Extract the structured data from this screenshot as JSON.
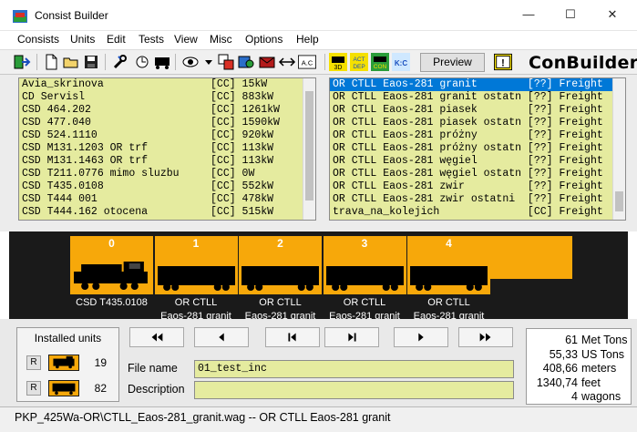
{
  "window": {
    "title": "Consist Builder",
    "minimize_glyph": "—",
    "maximize_glyph": "☐",
    "close_glyph": "✕"
  },
  "menu": [
    "Consists",
    "Units",
    "Edit",
    "Tests",
    "View",
    "Misc",
    "Options",
    "Help"
  ],
  "toolbar": {
    "preview_label": "Preview",
    "brand": "ConBuilder",
    "icons": [
      "exit-icon",
      "new-icon",
      "open-icon",
      "save-icon",
      "tools-icon",
      "search-icon",
      "wagon-icon",
      "view-icon",
      "dropdown-icon",
      "replace-icon",
      "match-icon",
      "mail-icon",
      "swap-icon",
      "ac-icon",
      "3d-icon",
      "act-dep-icon",
      "con-icon",
      "kc-icon",
      "help-icon"
    ],
    "ac_label": "A.C",
    "3d_label": "3D",
    "act_dep_label": "ACT DEP",
    "con_label": "CON",
    "kc_label": "K:C"
  },
  "left_list": [
    {
      "name": "Avia_skrinova",
      "tag": "[CC]",
      "value": "15kW"
    },
    {
      "name": "CD Servisl",
      "tag": "[CC]",
      "value": "883kW"
    },
    {
      "name": "CSD 464.202",
      "tag": "[CC]",
      "value": "1261kW"
    },
    {
      "name": "CSD 477.040",
      "tag": "[CC]",
      "value": "1590kW"
    },
    {
      "name": "CSD 524.1110",
      "tag": "[CC]",
      "value": "920kW"
    },
    {
      "name": "CSD M131.1203 OR trf",
      "tag": "[CC]",
      "value": "113kW"
    },
    {
      "name": "CSD M131.1463 OR trf",
      "tag": "[CC]",
      "value": "113kW"
    },
    {
      "name": "CSD T211.0776 mimo sluzbu",
      "tag": "[CC]",
      "value": "0W"
    },
    {
      "name": "CSD T435.0108",
      "tag": "[CC]",
      "value": "552kW"
    },
    {
      "name": "CSD T444 001",
      "tag": "[CC]",
      "value": "478kW"
    },
    {
      "name": "CSD T444.162 otocena",
      "tag": "[CC]",
      "value": "515kW"
    }
  ],
  "right_list": [
    {
      "name": "OR CTLL Eaos-281 granit",
      "tag": "[??]",
      "value": "Freight",
      "selected": true
    },
    {
      "name": "OR CTLL Eaos-281 granit ostatn",
      "tag": "[??]",
      "value": "Freight"
    },
    {
      "name": "OR CTLL Eaos-281 piasek",
      "tag": "[??]",
      "value": "Freight"
    },
    {
      "name": "OR CTLL Eaos-281 piasek ostatn",
      "tag": "[??]",
      "value": "Freight"
    },
    {
      "name": "OR CTLL Eaos-281 próżny",
      "tag": "[??]",
      "value": "Freight"
    },
    {
      "name": "OR CTLL Eaos-281 próżny ostatn",
      "tag": "[??]",
      "value": "Freight"
    },
    {
      "name": "OR CTLL Eaos-281 węgiel",
      "tag": "[??]",
      "value": "Freight"
    },
    {
      "name": "OR CTLL Eaos-281 węgiel ostatn",
      "tag": "[??]",
      "value": "Freight"
    },
    {
      "name": "OR CTLL Eaos-281 zwir",
      "tag": "[??]",
      "value": "Freight"
    },
    {
      "name": "OR CTLL Eaos-281 zwir ostatni",
      "tag": "[??]",
      "value": "Freight"
    },
    {
      "name": "trava_na_kolejich",
      "tag": "[CC]",
      "value": "Freight"
    }
  ],
  "consist": [
    {
      "index": "0",
      "line1": "CSD T435.0108",
      "line2": "",
      "kind": "loco"
    },
    {
      "index": "1",
      "line1": "OR CTLL",
      "line2": "Eaos-281 granit",
      "kind": "wagon"
    },
    {
      "index": "2",
      "line1": "OR CTLL",
      "line2": "Eaos-281 granit",
      "kind": "wagon"
    },
    {
      "index": "3",
      "line1": "OR CTLL",
      "line2": "Eaos-281 granit",
      "kind": "wagon"
    },
    {
      "index": "4",
      "line1": "OR CTLL",
      "line2": "Eaos-281 granit",
      "kind": "wagon"
    }
  ],
  "installed": {
    "title": "Installed units",
    "reset_label": "R",
    "locos": "19",
    "wagons": "82"
  },
  "nav_buttons": [
    "first-button",
    "prev-button",
    "prev-step-button",
    "next-step-button",
    "next-button",
    "last-button"
  ],
  "fields": {
    "file_name_label": "File name",
    "file_name_value": "01_test_inc",
    "description_label": "Description",
    "description_value": ""
  },
  "stats": [
    {
      "value": "61",
      "unit": "Met Tons"
    },
    {
      "value": "55,33",
      "unit": "US Tons"
    },
    {
      "value": "408,66",
      "unit": "meters"
    },
    {
      "value": "1340,74",
      "unit": "feet"
    },
    {
      "value": "4",
      "unit": "wagons"
    }
  ],
  "status": "PKP_425Wa-OR\\CTLL_Eaos-281_granit.wag -- OR CTLL Eaos-281 granit",
  "colors": {
    "list_bg": "#e5eb9f",
    "strip_orange": "#f7a80a",
    "strip_bg": "#1a1a1a",
    "selection": "#0078d7"
  }
}
